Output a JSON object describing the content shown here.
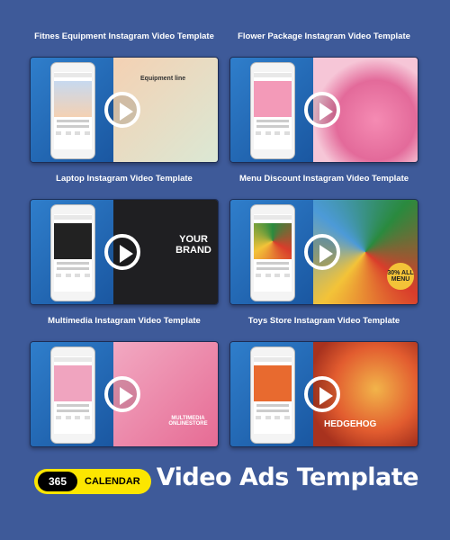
{
  "cards": [
    {
      "title": "Fitnes Equipment Instagram Video Template",
      "variant": "fitness",
      "overlay": "Equipment line"
    },
    {
      "title": "Flower Package Instagram Video Template",
      "variant": "flower",
      "overlay": ""
    },
    {
      "title": "Laptop Instagram Video Template",
      "variant": "laptop",
      "overlay": "YOUR BRAND"
    },
    {
      "title": "Menu Discount Instagram Video Template",
      "variant": "menu",
      "overlay": "30% ALL MENU"
    },
    {
      "title": "Multimedia Instagram Video Template",
      "variant": "multi",
      "overlay": "MULTIMEDIA ONLINESTORE"
    },
    {
      "title": "Toys Store Instagram Video Template",
      "variant": "toys",
      "overlay": "HEDGEHOG"
    }
  ],
  "badge": {
    "number": "365",
    "label": "CALENDAR"
  },
  "footer_title": "Video Ads Template"
}
